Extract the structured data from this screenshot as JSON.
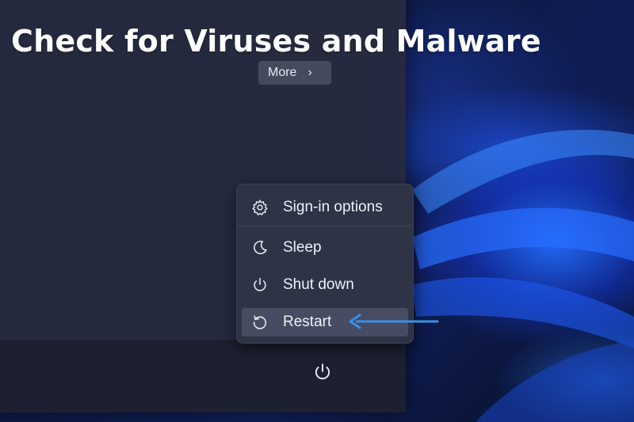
{
  "heading": "Check for Viruses and Malware",
  "start_menu": {
    "more_button": {
      "label": "More",
      "icon": "chevron-right-icon"
    }
  },
  "power_menu": {
    "items": [
      {
        "label": "Sign-in options",
        "icon": "gear-icon"
      },
      {
        "label": "Sleep",
        "icon": "moon-icon"
      },
      {
        "label": "Shut down",
        "icon": "power-icon"
      },
      {
        "label": "Restart",
        "icon": "restart-icon"
      }
    ],
    "highlighted_item": "Restart"
  },
  "power_button": {
    "icon": "power-icon"
  },
  "colors": {
    "annotation_arrow": "#3a8ee6",
    "panel": "#262b3e",
    "menu": "#2f3446"
  }
}
